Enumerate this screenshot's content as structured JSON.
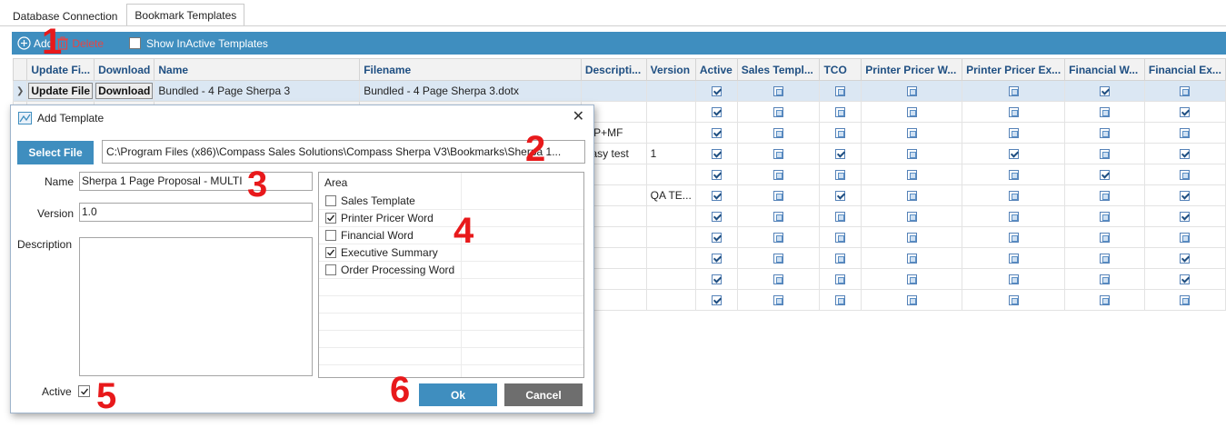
{
  "tabs": [
    {
      "label": "Database Connection"
    },
    {
      "label": "Bookmark Templates"
    }
  ],
  "toolbar": {
    "add_label": "Add",
    "delete_label": "Delete",
    "show_inactive_label": "Show InActive Templates"
  },
  "grid": {
    "columns": [
      "Update Fi...",
      "Download",
      "Name",
      "Filename",
      "Descripti...",
      "Version",
      "Active",
      "Sales Templ...",
      "TCO",
      "Printer Pricer W...",
      "Printer Pricer Ex...",
      "Financial W...",
      "Financial Ex..."
    ],
    "row0": {
      "update_btn": "Update File",
      "download_btn": "Download",
      "name": "Bundled - 4 Page Sherpa 3",
      "filename": "Bundled - 4 Page Sherpa 3.dotx"
    },
    "visible_descriptions": [
      "OP+MF",
      "easy test"
    ],
    "visible_versions": [
      "1",
      "QA TE..."
    ]
  },
  "dialog": {
    "title": "Add Template",
    "select_file_label": "Select File",
    "file_path": "C:\\Program Files (x86)\\Compass Sales Solutions\\Compass Sherpa V3\\Bookmarks\\Sherpa 1...",
    "name_label": "Name",
    "name_value": "Sherpa 1 Page Proposal - MULTI",
    "version_label": "Version",
    "version_value": "1.0",
    "description_label": "Description",
    "active_label": "Active",
    "area_header": "Area",
    "areas": [
      {
        "label": "Sales Template",
        "checked": false
      },
      {
        "label": "Printer Pricer Word",
        "checked": true
      },
      {
        "label": "Financial Word",
        "checked": false
      },
      {
        "label": "Executive Summary",
        "checked": true
      },
      {
        "label": "Order Processing Word",
        "checked": false
      }
    ],
    "ok_label": "Ok",
    "cancel_label": "Cancel"
  },
  "annotations": [
    "1",
    "2",
    "3",
    "4",
    "5",
    "6"
  ]
}
